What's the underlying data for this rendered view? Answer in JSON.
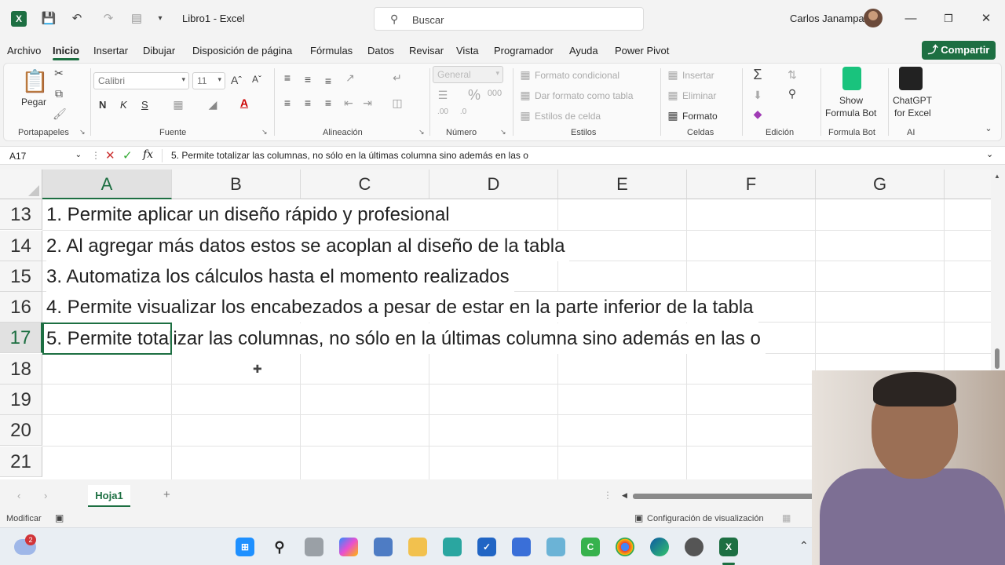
{
  "window": {
    "doc_title": "Libro1  -  Excel",
    "search_placeholder": "Buscar",
    "user_name": "Carlos Janampa"
  },
  "menu": {
    "tabs": [
      "Archivo",
      "Inicio",
      "Insertar",
      "Dibujar",
      "Disposición de página",
      "Fórmulas",
      "Datos",
      "Revisar",
      "Vista",
      "Programador",
      "Ayuda",
      "Power Pivot"
    ],
    "active": "Inicio",
    "share_label": "Compartir"
  },
  "ribbon": {
    "clipboard": {
      "paste": "Pegar",
      "label": "Portapapeles"
    },
    "font": {
      "family": "Calibri",
      "size": "11",
      "bold": "N",
      "italic": "K",
      "underline": "S",
      "label": "Fuente"
    },
    "alignment": {
      "label": "Alineación"
    },
    "number": {
      "format": "General",
      "label": "Número"
    },
    "styles": {
      "conditional": "Formato condicional",
      "as_table": "Dar formato como tabla",
      "cell_styles": "Estilos de celda",
      "label": "Estilos"
    },
    "cells": {
      "insert": "Insertar",
      "delete": "Eliminar",
      "format": "Formato",
      "label": "Celdas"
    },
    "editing": {
      "label": "Edición"
    },
    "formula_bot": {
      "line1": "Show",
      "line2": "Formula Bot",
      "label": "Formula Bot"
    },
    "chatgpt": {
      "line1": "ChatGPT",
      "line2": "for Excel",
      "label": "AI"
    }
  },
  "formula_bar": {
    "name_box": "A17",
    "content": "5. Permite totalizar las columnas, no sólo en la últimas columna sino además en las o"
  },
  "sheet": {
    "columns": [
      "A",
      "B",
      "C",
      "D",
      "E",
      "F",
      "G"
    ],
    "selected_column": "A",
    "rows": [
      "13",
      "14",
      "15",
      "16",
      "17",
      "18",
      "19",
      "20",
      "21"
    ],
    "selected_row": "17",
    "cells": [
      "1. Permite aplicar un diseño rápido y profesional",
      "2. Al agregar más datos estos se acoplan al diseño de la tabla",
      "3. Automatiza los cálculos hasta el momento realizados",
      "4. Permite visualizar los encabezados a pesar de estar en la parte inferior de la tabla",
      "5. Permite totalizar las columnas, no sólo en la últimas columna sino además en las o"
    ]
  },
  "sheet_tabs": {
    "active": "Hoja1"
  },
  "status": {
    "mode": "Modificar",
    "view_settings": "Configuración de visualización"
  },
  "taskbar": {
    "notification_count": "2"
  },
  "colors": {
    "accent": "#1d6f42"
  }
}
